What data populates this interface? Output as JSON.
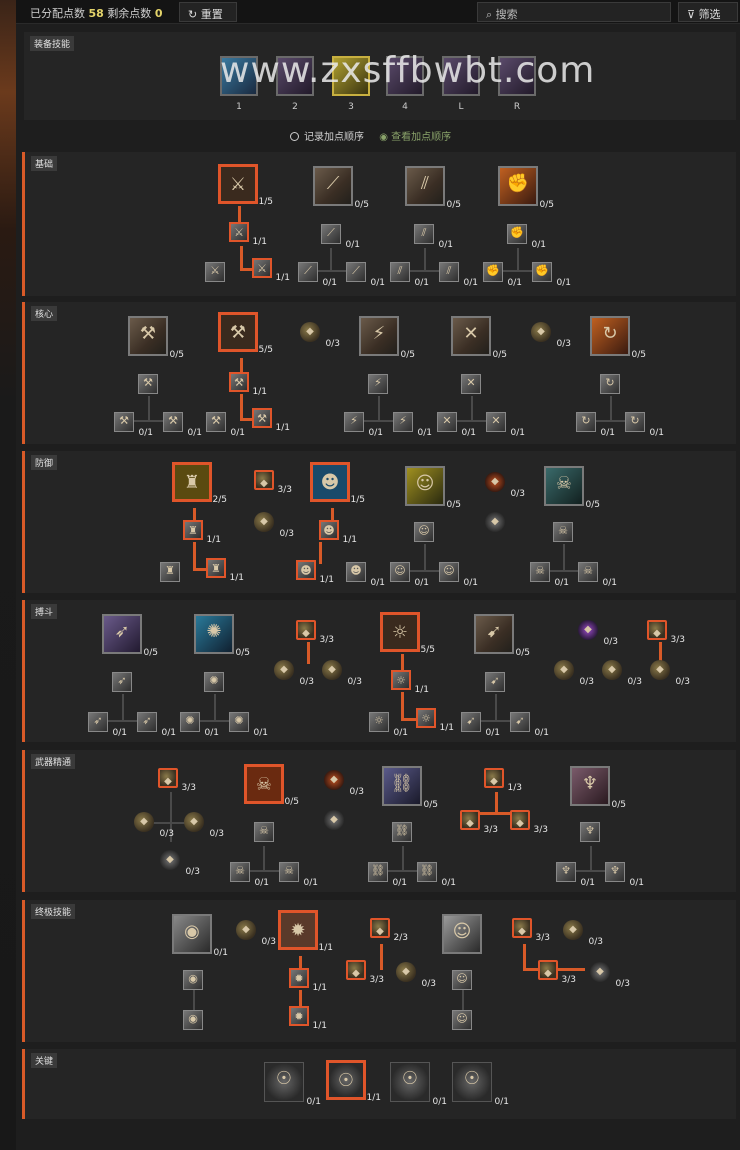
{
  "topbar": {
    "allocated_label": "已分配点数",
    "allocated": "58",
    "remaining_label": "剩余点数",
    "remaining": "0",
    "reset_label": "重置",
    "search_placeholder": "搜索",
    "filter_label": "筛选"
  },
  "equip": {
    "title": "装备技能",
    "slots": [
      {
        "key": "1"
      },
      {
        "key": "2"
      },
      {
        "key": "3"
      },
      {
        "key": "4"
      },
      {
        "key": "L"
      },
      {
        "key": "R"
      }
    ],
    "record_order_label": "记录加点顺序",
    "view_order_label": "查看加点顺序"
  },
  "watermark": "www.zxsffbwbt.com",
  "sections": [
    {
      "id": "basic",
      "title": "基础"
    },
    {
      "id": "core",
      "title": "核心"
    },
    {
      "id": "defense",
      "title": "防御"
    },
    {
      "id": "brawl",
      "title": "搏斗"
    },
    {
      "id": "weapon",
      "title": "武器精通"
    },
    {
      "id": "ultimate",
      "title": "终极技能"
    },
    {
      "id": "key",
      "title": "关键"
    }
  ],
  "nodes": {
    "b1": "1/5",
    "b2": "0/5",
    "b3": "0/5",
    "b4": "0/5",
    "b1a": "1/1",
    "b1b": "",
    "b1c": "1/1",
    "b2a": "0/1",
    "b2b": "0/1",
    "b2c": "0/1",
    "b3a": "0/1",
    "b3b": "0/1",
    "b3c": "0/1",
    "b4a": "0/1",
    "b4b": "0/1",
    "b4c": "0/1",
    "c1": "0/5",
    "c2": "5/5",
    "c3": "0/3",
    "c4": "0/5",
    "c5": "0/5",
    "c6": "0/3",
    "c7": "0/5",
    "c1a": "",
    "c1b": "0/1",
    "c1c": "0/1",
    "c2a": "1/1",
    "c2b": "0/1",
    "c2c": "1/1",
    "c4a": "",
    "c4b": "0/1",
    "c4c": "0/1",
    "c5a": "",
    "c5b": "0/1",
    "c5c": "0/1",
    "c7a": "",
    "c7b": "0/1",
    "c7c": "0/1",
    "d1": "2/5",
    "d2": "3/3",
    "d3": "1/5",
    "d4": "0/5",
    "d5": "0/3",
    "d6": "0/5",
    "d2a": "0/3",
    "d5a": "",
    "d1a": "1/1",
    "d1b": "",
    "d1c": "1/1",
    "d3a": "1/1",
    "d3b": "1/1",
    "d3c": "0/1",
    "d4a": "",
    "d4b": "0/1",
    "d4c": "0/1",
    "d6a": "",
    "d6b": "0/1",
    "d6c": "0/1",
    "r1": "0/5",
    "r2": "0/5",
    "r3": "3/3",
    "r4": "5/5",
    "r5": "0/5",
    "r6": "0/3",
    "r7": "3/3",
    "r3a": "0/3",
    "r3b": "0/3",
    "r6a": "0/3",
    "r6b": "0/3",
    "r7a": "0/3",
    "r1a": "",
    "r1b": "0/1",
    "r1c": "0/1",
    "r2a": "",
    "r2b": "0/1",
    "r2c": "0/1",
    "r4a": "1/1",
    "r4b": "0/1",
    "r4c": "1/1",
    "r5a": "",
    "r5b": "0/1",
    "r5c": "0/1",
    "w1": "3/3",
    "w1a": "0/3",
    "w1b": "0/3",
    "w1c": "0/3",
    "w2": "0/5",
    "w2a": "",
    "w2b": "0/1",
    "w2c": "0/1",
    "w3": "0/3",
    "w3a": "",
    "w4": "0/5",
    "w4a": "",
    "w4b": "0/1",
    "w4c": "0/1",
    "w5": "1/3",
    "w5a": "3/3",
    "w5b": "3/3",
    "w6": "0/5",
    "w6a": "",
    "w6b": "0/1",
    "w6c": "0/1",
    "u1": "0/1",
    "u1a": "",
    "u1b": "",
    "u2": "0/3",
    "u3": "1/1",
    "u3a": "1/1",
    "u3b": "1/1",
    "u4": "2/3",
    "u4a": "3/3",
    "u4b": "0/3",
    "u5": "",
    "u5a": "",
    "u5b": "",
    "u6": "3/3",
    "u6a": "3/3",
    "u6b": "0/3",
    "u7": "0/3",
    "k1": "0/1",
    "k2": "1/1",
    "k3": "0/1",
    "k4": "0/1"
  },
  "colors": {
    "accent": "#d85a28",
    "points": "#e3d36a",
    "view_order": "#8aa36a"
  }
}
